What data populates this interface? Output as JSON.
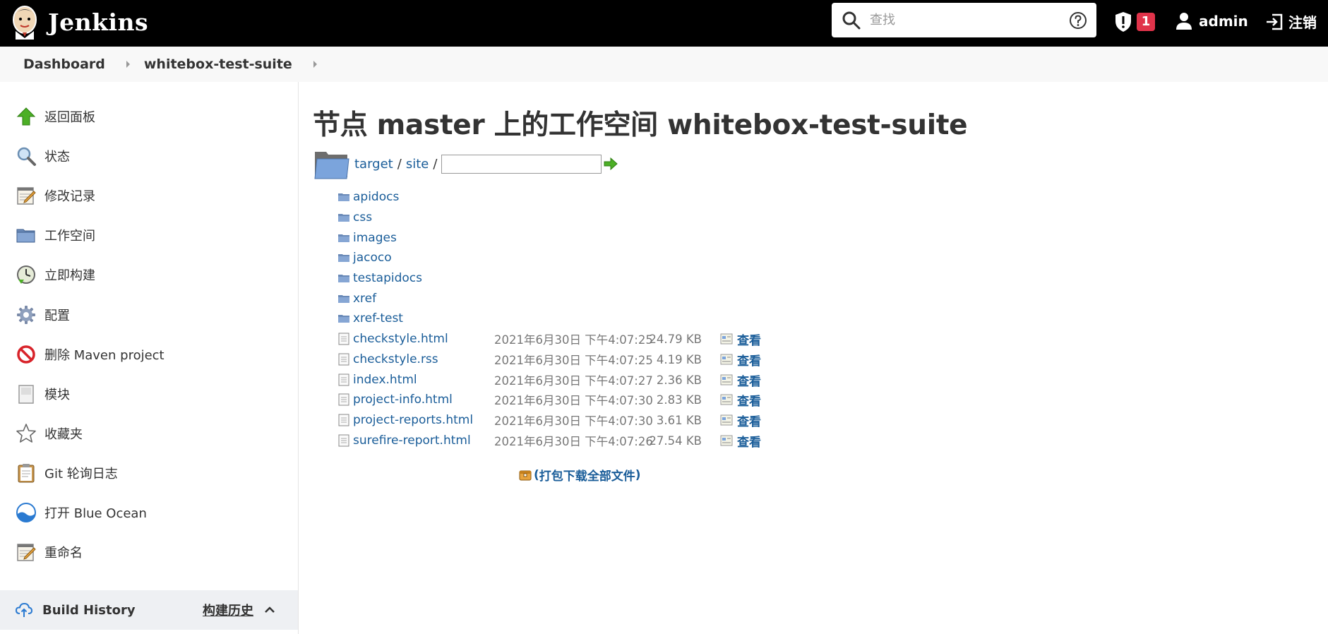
{
  "header": {
    "brand": "Jenkins",
    "search_placeholder": "查找",
    "security_count": "1",
    "user": "admin",
    "logout": "注销"
  },
  "breadcrumb": {
    "items": [
      "Dashboard",
      "whitebox-test-suite"
    ]
  },
  "sidebar": {
    "items": [
      {
        "label": "返回面板",
        "icon": "up-arrow-icon"
      },
      {
        "label": "状态",
        "icon": "magnifier-icon"
      },
      {
        "label": "修改记录",
        "icon": "notepad-icon"
      },
      {
        "label": "工作空间",
        "icon": "folder-icon"
      },
      {
        "label": "立即构建",
        "icon": "clock-icon"
      },
      {
        "label": "配置",
        "icon": "gear-icon"
      },
      {
        "label": "删除 Maven project",
        "icon": "no-entry-icon"
      },
      {
        "label": "模块",
        "icon": "document-icon"
      },
      {
        "label": "收藏夹",
        "icon": "star-icon"
      },
      {
        "label": "Git 轮询日志",
        "icon": "clipboard-icon"
      },
      {
        "label": "打开 Blue Ocean",
        "icon": "blue-ocean-icon"
      },
      {
        "label": "重命名",
        "icon": "notepad-icon"
      }
    ],
    "build_history": {
      "label": "Build History",
      "label_cn": "构建历史"
    }
  },
  "main": {
    "title": "节点 master 上的工作空间 whitebox-test-suite",
    "path": {
      "segments": [
        "target",
        "site"
      ],
      "separator": "/",
      "input_value": ""
    },
    "folders": [
      "apidocs",
      "css",
      "images",
      "jacoco",
      "testapidocs",
      "xref",
      "xref-test"
    ],
    "files": [
      {
        "name": "checkstyle.html",
        "date": "2021年6月30日 下午4:07:25",
        "size": "24.79 KB",
        "view": "查看"
      },
      {
        "name": "checkstyle.rss",
        "date": "2021年6月30日 下午4:07:25",
        "size": "4.19 KB",
        "view": "查看"
      },
      {
        "name": "index.html",
        "date": "2021年6月30日 下午4:07:27",
        "size": "2.36 KB",
        "view": "查看"
      },
      {
        "name": "project-info.html",
        "date": "2021年6月30日 下午4:07:30",
        "size": "2.83 KB",
        "view": "查看"
      },
      {
        "name": "project-reports.html",
        "date": "2021年6月30日 下午4:07:30",
        "size": "3.61 KB",
        "view": "查看"
      },
      {
        "name": "surefire-report.html",
        "date": "2021年6月30日 下午4:07:26",
        "size": "27.54 KB",
        "view": "查看"
      }
    ],
    "download": {
      "open": "(",
      "label": "打包下载全部文件",
      "close": ")"
    }
  },
  "colors": {
    "header_bg": "#000000",
    "link": "#1a5d99",
    "badge": "#e0334a"
  }
}
